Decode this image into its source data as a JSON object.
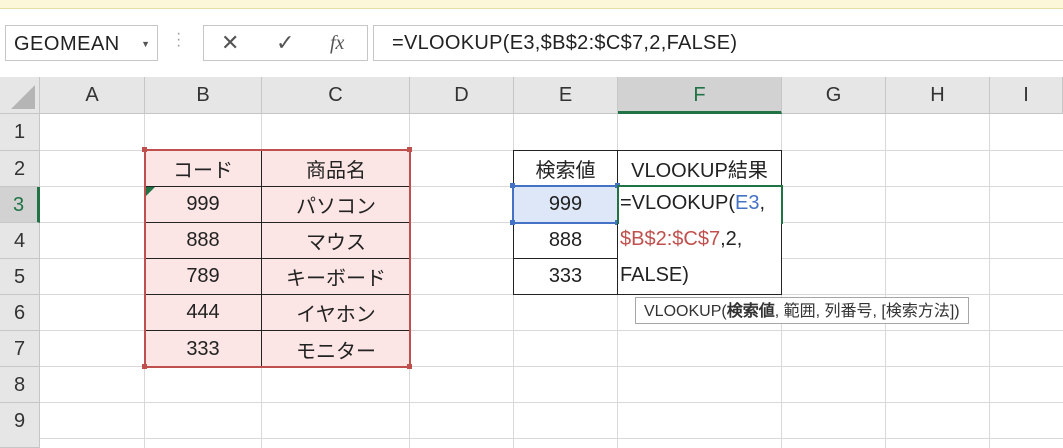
{
  "name_box": {
    "value": "GEOMEAN",
    "dropdown_icon": "caret-down-icon"
  },
  "formula_buttons": {
    "cancel": "✕",
    "enter": "✓",
    "fx": "fx"
  },
  "formula_bar": {
    "value": "=VLOOKUP(E3,$B$2:$C$7,2,FALSE)"
  },
  "columns": [
    "A",
    "B",
    "C",
    "D",
    "E",
    "F",
    "G",
    "H",
    "I"
  ],
  "rows": [
    "1",
    "2",
    "3",
    "4",
    "5",
    "6",
    "7",
    "8",
    "9"
  ],
  "table1": {
    "headers": [
      "コード",
      "商品名"
    ],
    "rows": [
      [
        "999",
        "パソコン"
      ],
      [
        "888",
        "マウス"
      ],
      [
        "789",
        "キーボード"
      ],
      [
        "444",
        "イヤホン"
      ],
      [
        "333",
        "モニター"
      ]
    ]
  },
  "table2": {
    "headers": [
      "検索値",
      "VLOOKUP結果"
    ],
    "values": [
      "999",
      "888",
      "333"
    ]
  },
  "edit": {
    "eq": "=VLOOKUP(",
    "ref1": "E3",
    "comma1": ",",
    "ref2": "$B$2:$C$7",
    "rest": ",2,",
    "line3": "FALSE)"
  },
  "tooltip": {
    "fn": "VLOOKUP(",
    "bold_arg": "検索値",
    "rest": ", 範囲, 列番号, [検索方法])"
  },
  "colors": {
    "ref_blue": "#4472c4",
    "ref_red": "#c0504d",
    "selected_green": "#217346"
  }
}
